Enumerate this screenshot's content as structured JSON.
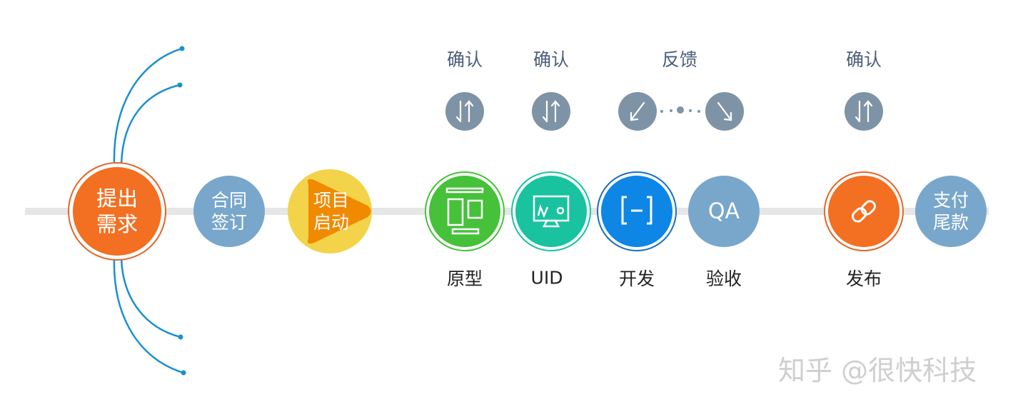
{
  "colors": {
    "track": "#e6e6e6",
    "orange": "#f36f21",
    "slate": "#78a7cb",
    "yellow": "#f3d34a",
    "play": "#f08a00",
    "green": "#46c13a",
    "teal": "#19c3a0",
    "blue": "#0d86e6",
    "arrow_bg": "#7e93a6",
    "curve": "#1a8fd0"
  },
  "nodes": {
    "requirement": "提出需求",
    "requirement_l1": "提出",
    "requirement_l2": "需求",
    "contract_l1": "合同",
    "contract_l2": "签订",
    "kickoff_l1": "项目",
    "kickoff_l2": "启动",
    "prototype": {
      "label": "原型",
      "icon": "layout-icon"
    },
    "uid": {
      "label": "UID",
      "icon": "monitor-icon"
    },
    "dev": {
      "label": "开发",
      "icon": "bracket-code-icon"
    },
    "qa": {
      "label": "验收",
      "badge": "QA"
    },
    "release": {
      "label": "发布",
      "icon": "link-icon"
    },
    "payment_l1": "支付",
    "payment_l2": "尾款"
  },
  "top_labels": [
    "确认",
    "确认",
    "反馈",
    "确认"
  ],
  "watermark": "知乎 @很快科技"
}
